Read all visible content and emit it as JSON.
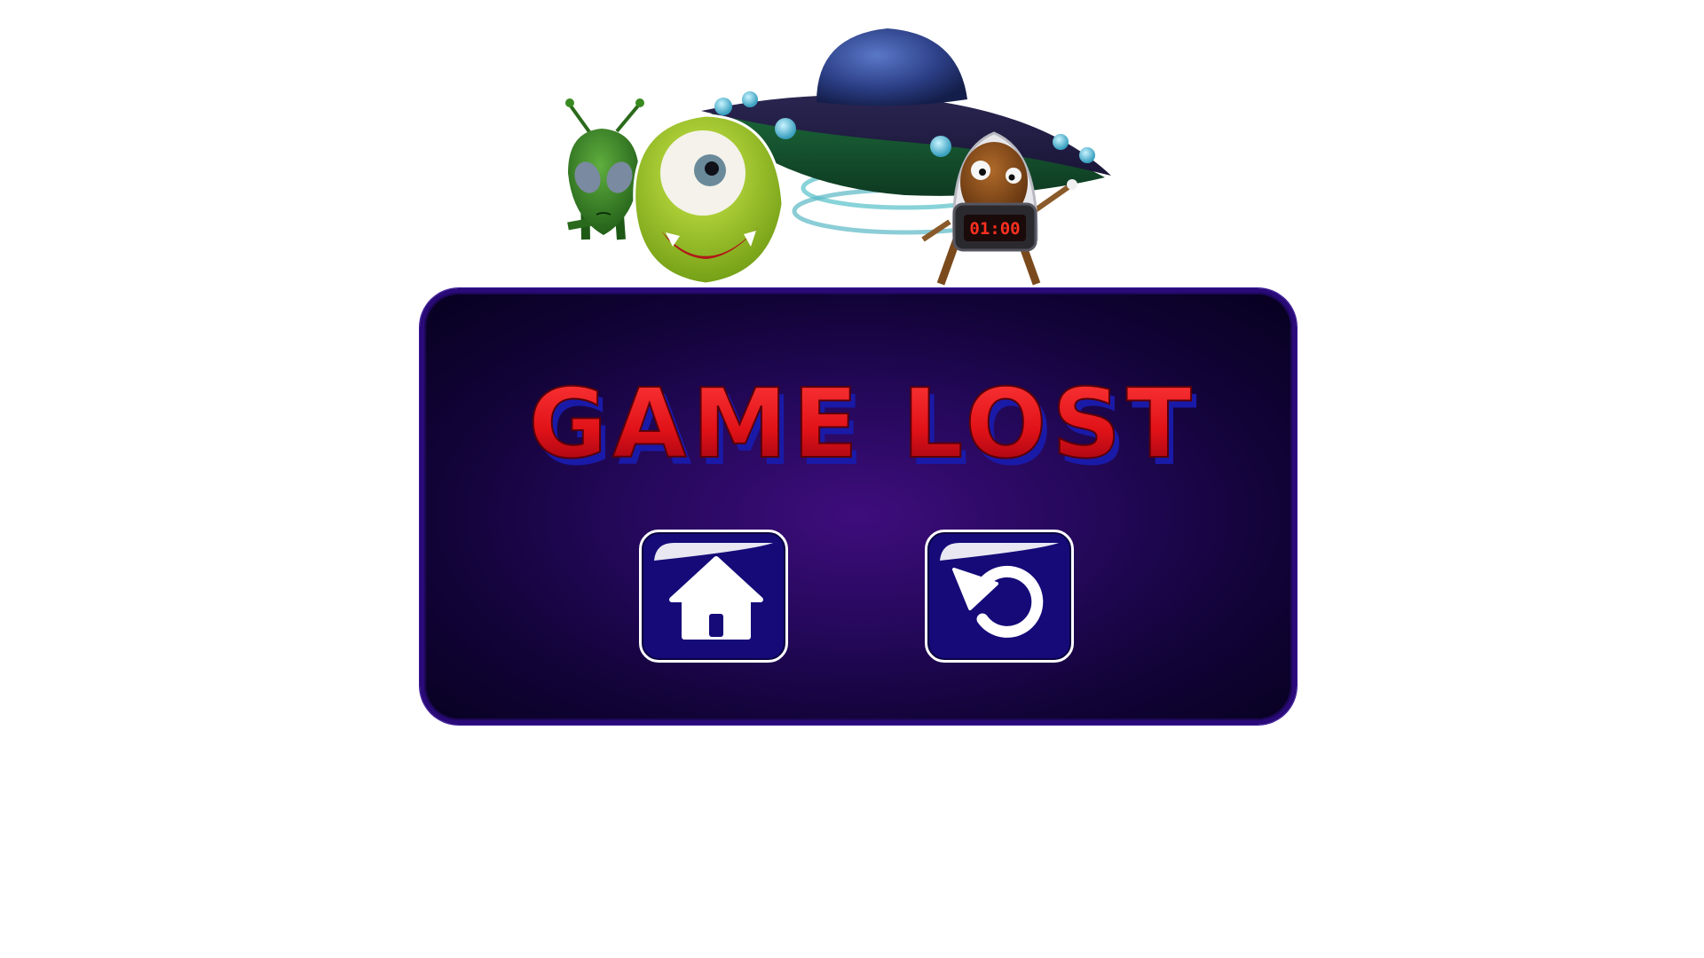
{
  "popup": {
    "title": "GAME LOST",
    "title_colors": {
      "fill_top": "#ff2a2a",
      "fill_bottom": "#b00010",
      "shadow": "#1a1aa8"
    },
    "panel_colors": {
      "center": "#3e0d7c",
      "edge": "#070120",
      "border": "#2a0a78"
    }
  },
  "buttons": {
    "home": {
      "icon": "home-icon",
      "color": "#150a78"
    },
    "restart": {
      "icon": "restart-icon",
      "color": "#150a78"
    }
  },
  "characters": {
    "timer_display": "01:00",
    "figures": [
      "green-alien",
      "one-eyed-monster",
      "flying-saucer",
      "robot-with-timer"
    ]
  }
}
